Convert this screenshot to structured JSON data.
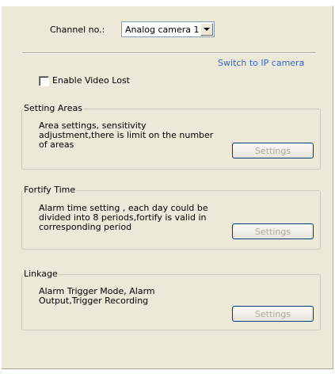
{
  "channel": {
    "label": "Channel no.:",
    "selected": "Analog camera 1"
  },
  "switch_link": "Switch to IP camera",
  "video_lost": {
    "label": "Enable Video Lost",
    "checked": false
  },
  "groups": [
    {
      "title": "Setting Areas",
      "desc_lines": [
        "Area settings, sensitivity",
        "adjustment,there is limit on the number",
        "of areas"
      ],
      "button": "Settings"
    },
    {
      "title": "Fortify Time",
      "desc_lines": [
        "Alarm time setting , each day could be",
        "divided into 8 periods,fortify is valid in",
        "corresponding period"
      ],
      "button": "Settings"
    },
    {
      "title": "Linkage",
      "desc_lines": [
        "Alarm Trigger Mode, Alarm",
        "Output,Trigger Recording"
      ],
      "button": "Settings"
    }
  ]
}
